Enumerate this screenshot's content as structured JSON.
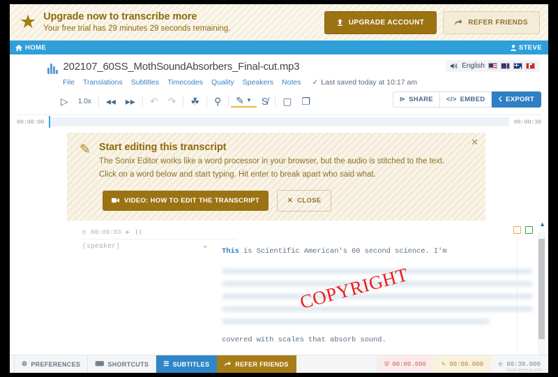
{
  "promo": {
    "star_icon": "star-icon",
    "title": "Upgrade now to transcribe more",
    "subtitle": "Your free trial has 29 minutes 29 seconds remaining.",
    "upgrade_label": "UPGRADE ACCOUNT",
    "upgrade_icon": "upload-arrow-icon",
    "refer_label": "REFER FRIENDS",
    "refer_icon": "share-arrow-icon",
    "bg_color": "#f6efdd",
    "gold_color": "#9b7313"
  },
  "navbar": {
    "home_label": "HOME",
    "home_icon": "home-icon",
    "user_label": "STEVE",
    "user_icon": "user-icon",
    "bg_color": "#2f9fda"
  },
  "file": {
    "name": "202107_60SS_MothSoundAbsorbers_Final-cut.mp3",
    "waveform_icon": "waveform-icon",
    "menu": [
      "File",
      "Translations",
      "Subtitles",
      "Timecodes",
      "Quality",
      "Speakers",
      "Notes"
    ],
    "saved_text": "Last saved today at 10:17 am",
    "saved_icon": "check-icon"
  },
  "language": {
    "speaker_icon": "volume-icon",
    "label": "English",
    "flags": [
      "flag-us",
      "flag-uk",
      "flag-au",
      "flag-ca"
    ]
  },
  "toolbar": {
    "play_icon": "play-icon",
    "speed_label": "1.0x",
    "rewind_icon": "rewind-icon",
    "forward_icon": "fast-forward-icon",
    "undo_icon": "undo-icon",
    "redo_icon": "redo-icon",
    "mic_icon": "microphone-icon",
    "search_icon": "search-icon",
    "highlighter_icon": "highlighter-icon",
    "highlighter_caret_icon": "chevron-down-icon",
    "strikethrough_icon": "strikethrough-icon",
    "dictionary_icon": "dictionary-icon",
    "copy_icon": "copy-icon",
    "share_label": "SHARE",
    "share_icon": "share-nodes-icon",
    "embed_label": "EMBED",
    "embed_icon": "code-icon",
    "export_label": "EXPORT",
    "export_icon": "export-icon",
    "export_color": "#2f7fc4"
  },
  "timeline": {
    "start_time": "00:00:00",
    "end_time": "00:00:30",
    "playhead_color": "#3aa0dd"
  },
  "tip": {
    "pencil_icon": "pencil-icon",
    "title": "Start editing this transcript",
    "body": "The Sonix Editor works like a word processor in your browser, but the audio is stitched to the text. Click on a word below and start typing. Hit enter to break apart who said what.",
    "video_label": "VIDEO: HOW TO EDIT THE TRANSCRIPT",
    "video_icon": "video-camera-icon",
    "close_label": "CLOSE",
    "close_icon": "x-icon",
    "dismiss_icon": "close-icon"
  },
  "transcript": {
    "segment_time": "00:00:03",
    "clock_icon": "clock-icon",
    "play_icon": "play-icon",
    "pause_icon": "pause-icon",
    "speaker_label": "(speaker)",
    "speaker_caret_icon": "chevron-right-icon",
    "first_word": "This",
    "line_rest": " is Scientific American's 60 second science. I'm",
    "hidden_lines": 5,
    "last_line": "covered with scales that absorb sound.",
    "watermark": "COPYRIGHT",
    "watermark_color": "#ee1c1c",
    "note_icon": "note-icon",
    "square_icon": "square-icon"
  },
  "scrollbar": {
    "up_icon": "caret-up-icon",
    "down_icon": "caret-down-icon"
  },
  "bottombar": {
    "preferences_label": "PREFERENCES",
    "preferences_icon": "gear-icon",
    "shortcuts_label": "SHORTCUTS",
    "shortcuts_icon": "keyboard-icon",
    "subtitles_label": "SUBTITLES",
    "subtitles_icon": "lines-icon",
    "refer_label": "REFER FRIENDS",
    "refer_icon": "share-arrow-icon",
    "timecode_strike": "00:00.000",
    "timecode_strike_icon": "strikethrough-icon",
    "timecode_edit": "00:00.000",
    "timecode_edit_icon": "pencil-icon",
    "timecode_total": "00:30.000",
    "timecode_total_icon": "clock-icon",
    "subtitles_color": "#2f86c6",
    "refer_color": "#a87c16"
  },
  "watermark_bottom": "www.dewua.com"
}
